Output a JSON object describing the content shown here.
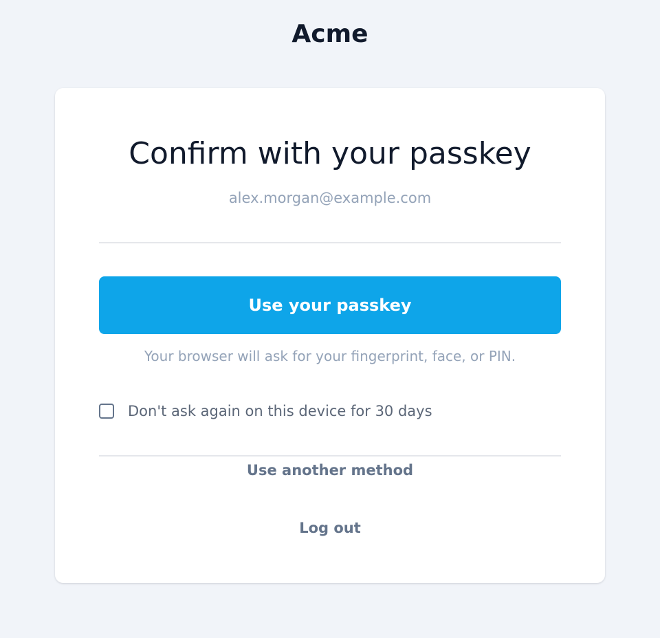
{
  "brand": {
    "name": "Acme"
  },
  "card": {
    "heading": "Confirm with your passkey",
    "email": "alex.morgan@example.com",
    "passkey_button_label": "Use your passkey",
    "hint": "Your browser will ask for your fingerprint, face, or PIN.",
    "remember": {
      "label": "Don't ask again on this device for 30 days",
      "checked": false
    },
    "another_method_label": "Use another method",
    "logout_label": "Log out"
  },
  "colors": {
    "page_background": "#f1f4f9",
    "card_background": "#ffffff",
    "primary_button": "#0ea5e9",
    "heading_text": "#111a2c",
    "muted_text": "#94a3b8",
    "link_text": "#64748b"
  }
}
